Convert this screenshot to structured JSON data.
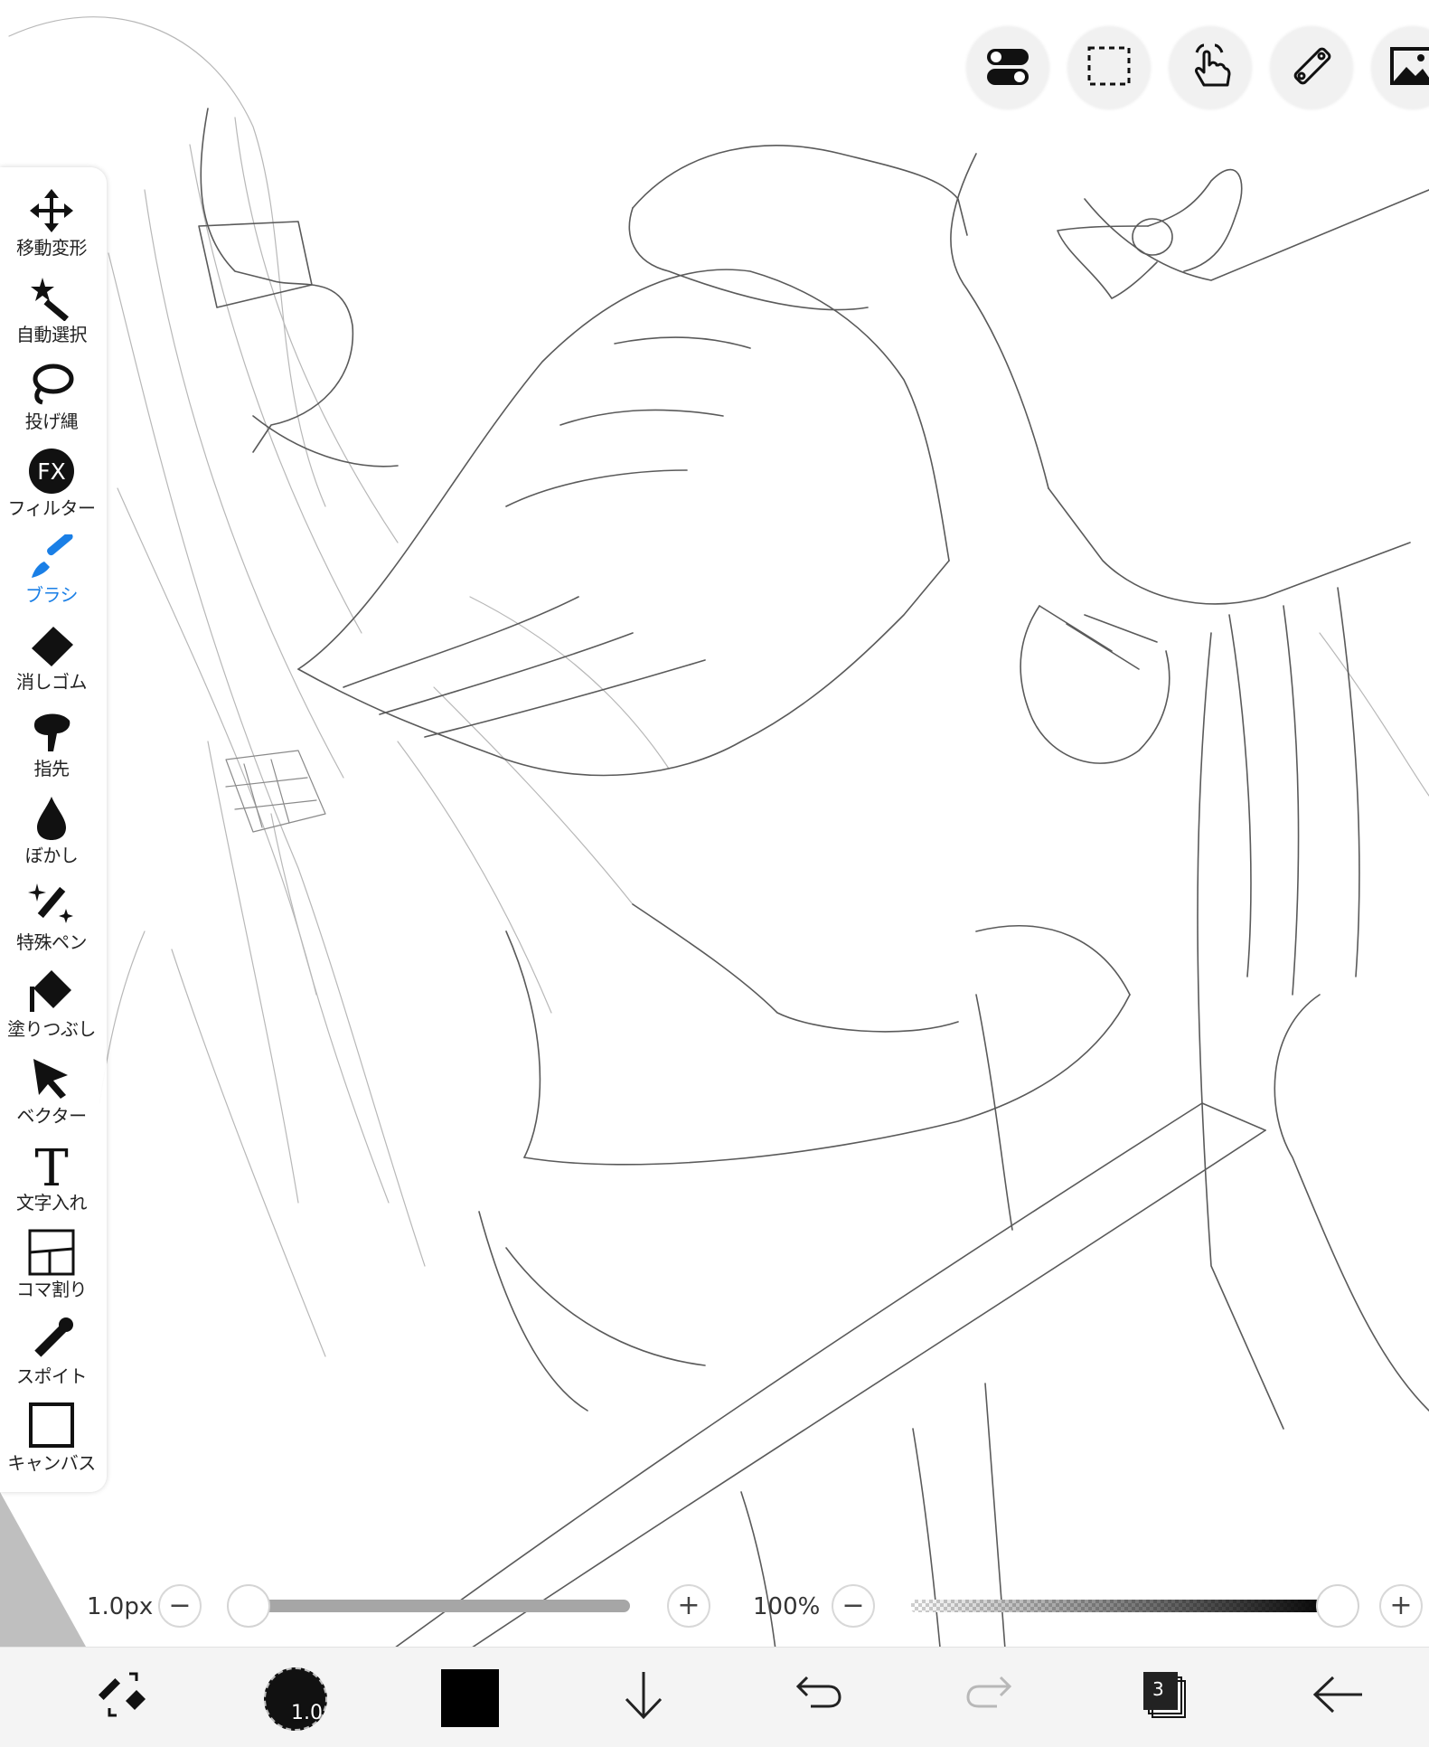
{
  "toolbar": {
    "items": [
      {
        "id": "move",
        "label": "移動変形",
        "icon": "move-arrows-icon",
        "active": false
      },
      {
        "id": "auto-select",
        "label": "自動選択",
        "icon": "magic-wand-icon",
        "active": false
      },
      {
        "id": "lasso",
        "label": "投げ縄",
        "icon": "lasso-icon",
        "active": false
      },
      {
        "id": "filter",
        "label": "フィルター",
        "icon": "fx-icon",
        "icon_text": "FX",
        "active": false
      },
      {
        "id": "brush",
        "label": "ブラシ",
        "icon": "brush-icon",
        "active": true
      },
      {
        "id": "eraser",
        "label": "消しゴム",
        "icon": "eraser-icon",
        "active": false
      },
      {
        "id": "finger",
        "label": "指先",
        "icon": "finger-icon",
        "active": false
      },
      {
        "id": "blur",
        "label": "ぼかし",
        "icon": "drop-icon",
        "active": false
      },
      {
        "id": "special-pen",
        "label": "特殊ペン",
        "icon": "sparkle-pen-icon",
        "active": false
      },
      {
        "id": "fill",
        "label": "塗りつぶし",
        "icon": "bucket-icon",
        "active": false
      },
      {
        "id": "vector",
        "label": "ベクター",
        "icon": "cursor-arrow-icon",
        "active": false
      },
      {
        "id": "text",
        "label": "文字入れ",
        "icon": "text-icon",
        "icon_text": "T",
        "active": false
      },
      {
        "id": "frame",
        "label": "コマ割り",
        "icon": "frame-divider-icon",
        "active": false
      },
      {
        "id": "eyedropper",
        "label": "スポイト",
        "icon": "eyedropper-icon",
        "active": false
      },
      {
        "id": "canvas",
        "label": "キャンバス",
        "icon": "canvas-square-icon",
        "active": false
      }
    ],
    "active_color": "#1a7fe6"
  },
  "top_buttons": [
    {
      "id": "toggle",
      "icon": "toggle-switch-icon"
    },
    {
      "id": "selection",
      "icon": "dashed-selection-icon"
    },
    {
      "id": "touch",
      "icon": "hand-touch-icon"
    },
    {
      "id": "ruler",
      "icon": "ruler-icon"
    },
    {
      "id": "reference",
      "icon": "image-icon"
    }
  ],
  "sliders": {
    "brush_size": {
      "text": "1.0px",
      "value": 0.0,
      "minus": "−",
      "plus": "+"
    },
    "opacity": {
      "text": "100%",
      "value": 1.0,
      "minus": "−",
      "plus": "+"
    }
  },
  "bottom_bar": {
    "brush_size_label": "1.0",
    "color": "#000000",
    "layers_count": "3"
  }
}
